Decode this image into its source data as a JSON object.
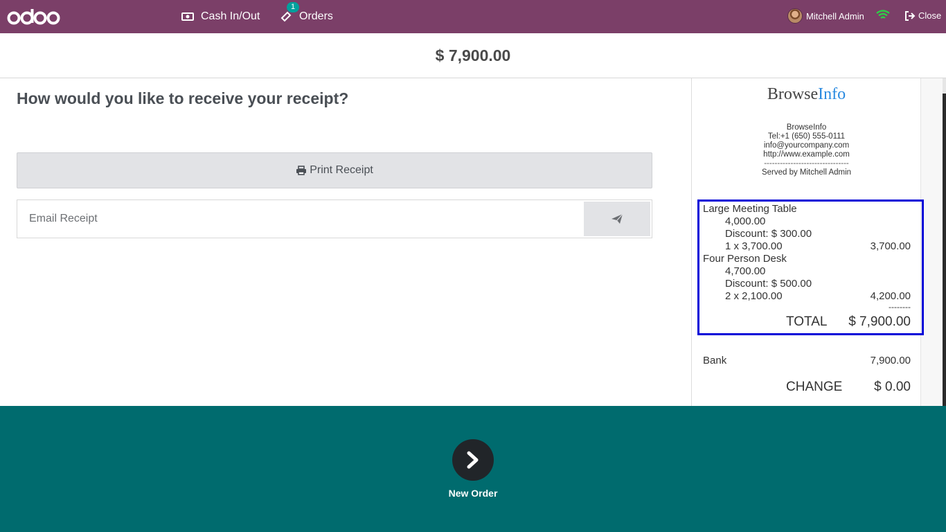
{
  "topbar": {
    "logo_text": "odoo",
    "cash_label": "Cash In/Out",
    "orders_label": "Orders",
    "orders_badge": "1",
    "user_name": "Mitchell Admin",
    "close_label": "Close",
    "bg_color": "#7b3f68"
  },
  "amount": "$ 7,900.00",
  "left": {
    "question": "How would you like to receive your receipt?",
    "print_label": "Print Receipt",
    "email_placeholder": "Email Receipt"
  },
  "receipt": {
    "company_part1": "Browse",
    "company_part2": "Info",
    "contact_lines": [
      "BrowseInfo",
      "Tel:+1 (650) 555-0111",
      "info@yourcompany.com",
      "http://www.example.com",
      "--------------------------------",
      "Served by Mitchell Admin"
    ],
    "lines": [
      {
        "product": "Large Meeting Table",
        "unit_price": "4,000.00",
        "discount": "Discount: $ 300.00",
        "qty_price": "1 x 3,700.00",
        "total": "3,700.00"
      },
      {
        "product": "Four Person Desk",
        "unit_price": "4,700.00",
        "discount": "Discount: $ 500.00",
        "qty_price": "2 x 2,100.00",
        "total": "4,200.00"
      }
    ],
    "separator": "--------",
    "total_label": "TOTAL",
    "total_value": "$ 7,900.00",
    "payment_method": "Bank",
    "payment_amount": "7,900.00",
    "change_label": "CHANGE",
    "change_value": "$ 0.00"
  },
  "footer": {
    "new_order_label": "New Order",
    "bg_color": "#006b6e"
  }
}
